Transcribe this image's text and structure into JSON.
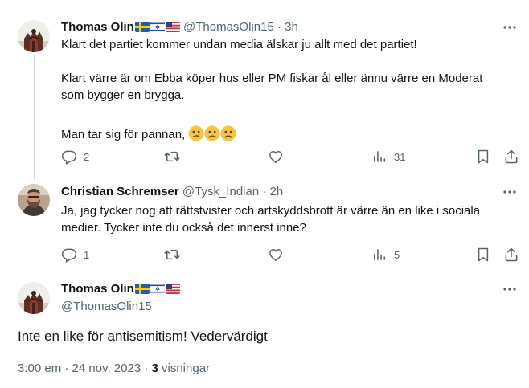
{
  "tweets": [
    {
      "name": "Thomas Olin",
      "handle": "@ThomasOlin15",
      "sep": " · ",
      "time": "3h",
      "lines": [
        "Klart det partiet kommer undan media älskar ju allt med det partiet!",
        "",
        "Klart värre är om Ebba köper hus eller PM fiskar ål eller ännu värre en Moderat",
        "som bygger en brygga.",
        "",
        "Man tar sig för pannan,"
      ],
      "replies": "2",
      "views": "31"
    },
    {
      "name": "Christian Schremser",
      "handle": "@Tysk_Indian",
      "sep": " · ",
      "time": "2h",
      "lines": [
        "Ja, jag tycker nog att rättstvister och artskyddsbrott är värre än en like i sociala",
        "medier. Tycker inte du också det innerst inne?"
      ],
      "replies": "1",
      "views": "5"
    }
  ],
  "main": {
    "name": "Thomas Olin",
    "handle": "@ThomasOlin15",
    "text": "Inte en like för antisemitism! Vedervärdigt",
    "timestamp": "3:00 em · 24 nov. 2023 · ",
    "views_count": "3",
    "views_label": " visningar"
  },
  "colors": {
    "text": "#0f1419",
    "muted": "#536471",
    "thread_line": "#cfd9de",
    "emoji": "#f6c440"
  },
  "icons": [
    "reply-icon",
    "retweet-icon",
    "like-icon",
    "views-icon",
    "bookmark-icon",
    "share-icon",
    "more-icon",
    "flag-sweden-icon",
    "flag-israel-icon",
    "flag-usa-icon",
    "emoji-confused-icon",
    "emoji-frown-icon"
  ]
}
